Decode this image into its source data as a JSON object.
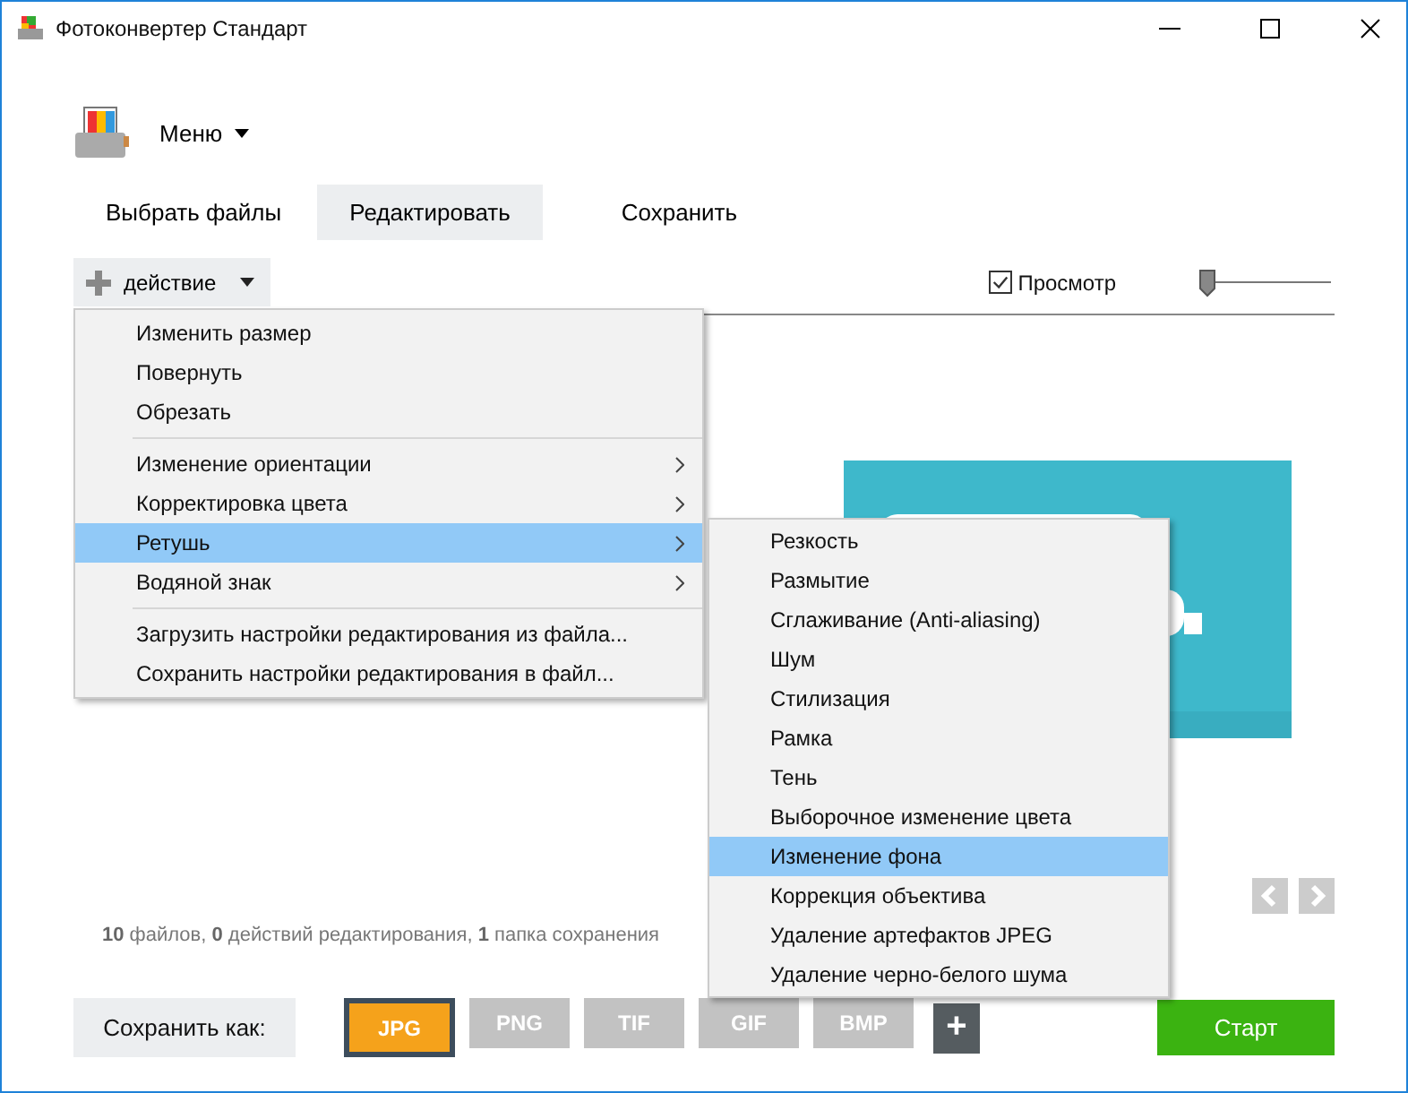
{
  "window": {
    "title": "Фотоконвертер Стандарт"
  },
  "app_menu": {
    "label": "Меню"
  },
  "tabs": [
    {
      "label": "Выбрать файлы",
      "selected": false
    },
    {
      "label": "Редактировать",
      "selected": true
    },
    {
      "label": "Сохранить",
      "selected": false
    }
  ],
  "action_button": {
    "label": "действие"
  },
  "preview": {
    "label": "Просмотр",
    "checked": true,
    "zoom": {
      "level": 0.03
    }
  },
  "action_menu": {
    "groups": [
      [
        {
          "label": "Изменить размер",
          "has_submenu": false,
          "selected": false
        },
        {
          "label": "Повернуть",
          "has_submenu": false,
          "selected": false
        },
        {
          "label": "Обрезать",
          "has_submenu": false,
          "selected": false
        }
      ],
      [
        {
          "label": "Изменение ориентации",
          "has_submenu": true,
          "selected": false
        },
        {
          "label": "Корректировка цвета",
          "has_submenu": true,
          "selected": false
        },
        {
          "label": "Ретушь",
          "has_submenu": true,
          "selected": true
        },
        {
          "label": "Водяной знак",
          "has_submenu": true,
          "selected": false
        }
      ],
      [
        {
          "label": "Загрузить настройки редактирования из файла...",
          "has_submenu": false,
          "selected": false
        },
        {
          "label": "Сохранить настройки редактирования в файл...",
          "has_submenu": false,
          "selected": false
        }
      ]
    ]
  },
  "submenu": {
    "items": [
      {
        "label": "Резкость",
        "selected": false
      },
      {
        "label": "Размытие",
        "selected": false
      },
      {
        "label": "Сглаживание (Anti-aliasing)",
        "selected": false
      },
      {
        "label": "Шум",
        "selected": false
      },
      {
        "label": "Стилизация",
        "selected": false
      },
      {
        "label": "Рамка",
        "selected": false
      },
      {
        "label": "Тень",
        "selected": false
      },
      {
        "label": "Выборочное изменение цвета",
        "selected": false
      },
      {
        "label": "Изменение фона",
        "selected": true
      },
      {
        "label": "Коррекция объектива",
        "selected": false
      },
      {
        "label": "Удаление артефактов JPEG",
        "selected": false
      },
      {
        "label": "Удаление черно-белого шума",
        "selected": false
      }
    ]
  },
  "status": "**10** файлов, **0** действий редактирования, **1** папка сохранения",
  "save_as": {
    "label": "Сохранить как:",
    "formats": [
      {
        "label": "JPG",
        "selected": true
      },
      {
        "label": "PNG",
        "selected": false
      },
      {
        "label": "TIF",
        "selected": false
      },
      {
        "label": "GIF",
        "selected": false
      },
      {
        "label": "BMP",
        "selected": false
      }
    ],
    "add": "+"
  },
  "start_button": "Старт"
}
